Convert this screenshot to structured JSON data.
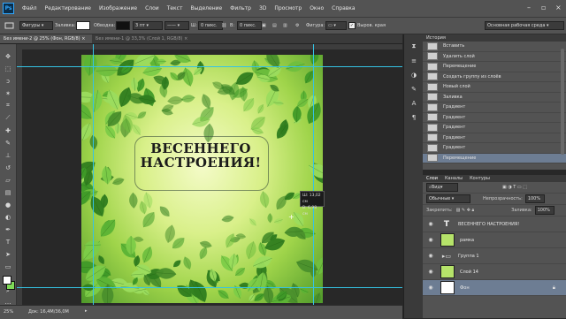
{
  "menubar": {
    "logo": "Ps",
    "items": [
      "Файл",
      "Редактирование",
      "Изображение",
      "Слои",
      "Текст",
      "Выделение",
      "Фильтр",
      "3D",
      "Просмотр",
      "Окно",
      "Справка"
    ]
  },
  "options": {
    "shape_mode": "Фигуры",
    "fill_label": "Заливка:",
    "stroke_label": "Обводка:",
    "stroke_size": "3 пт",
    "w_label": "Ш:",
    "w_value": "0 пикс.",
    "h_label": "В:",
    "h_value": "0 пикс.",
    "shape_label": "Фигура:",
    "align_edges": "Выров. края",
    "workspace": "Основная рабочая среда"
  },
  "tabs": [
    {
      "label": "Без имени-2 @ 25% (Фон, RGB/8)",
      "active": true
    },
    {
      "label": "Без имени-1 @ 33,3% (Слой 1, RGB/8)",
      "active": false
    }
  ],
  "canvas": {
    "title_line1": "ВЕСЕННЕГО",
    "title_line2": "НАСТРОЕНИЯ!",
    "measure_w_label": "Ш:",
    "measure_w_value": "13,02 см",
    "measure_h_label": "В:",
    "measure_h_value": "6,98 см"
  },
  "status": {
    "zoom": "25%",
    "doc": "Док: 16,4М/36,0М"
  },
  "history": {
    "title": "История",
    "items": [
      {
        "label": "Вставить",
        "active": false
      },
      {
        "label": "Удалить слой",
        "active": false
      },
      {
        "label": "Перемещение",
        "active": false
      },
      {
        "label": "Создать группу из слоёв",
        "active": false
      },
      {
        "label": "Новый слой",
        "active": false
      },
      {
        "label": "Заливка",
        "active": false
      },
      {
        "label": "Градиент",
        "active": false
      },
      {
        "label": "Градиент",
        "active": false
      },
      {
        "label": "Градиент",
        "active": false
      },
      {
        "label": "Градиент",
        "active": false
      },
      {
        "label": "Градиент",
        "active": false
      },
      {
        "label": "Перемещение",
        "active": true
      }
    ]
  },
  "layers_panel": {
    "tabs": [
      "Слои",
      "Каналы",
      "Контуры"
    ],
    "filter_label": "Вид",
    "blend_mode": "Обычные",
    "opacity_label": "Непрозрачность:",
    "opacity_value": "100%",
    "lock_label": "Закрепить:",
    "fill_label": "Заливка:",
    "fill_value": "100%",
    "layers": [
      {
        "name": "ВЕСЕННЕГО НАСТРОЕНИЯ!",
        "kind": "text",
        "active": false
      },
      {
        "name": "рамка",
        "kind": "image",
        "active": false
      },
      {
        "name": "Группа 1",
        "kind": "group",
        "active": false
      },
      {
        "name": "Слой 14",
        "kind": "image",
        "active": false
      },
      {
        "name": "Фон",
        "kind": "background",
        "active": true
      }
    ]
  },
  "colors": {
    "foreground": "#ffffff",
    "background": "#7ed957",
    "guides": "#35c3e4",
    "selection": "#6d7d93"
  }
}
